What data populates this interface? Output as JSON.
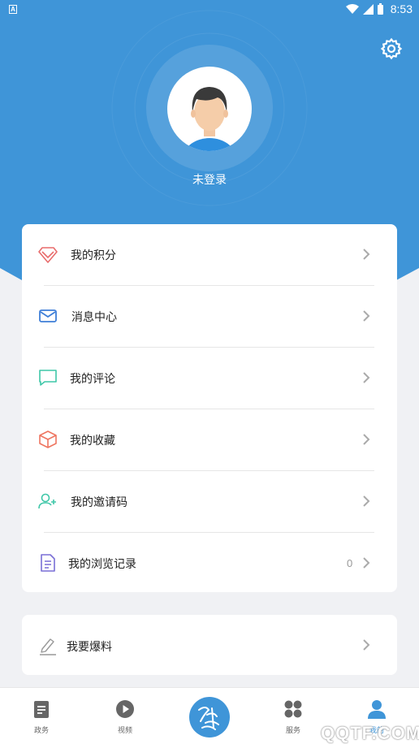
{
  "status": {
    "badge": "A",
    "time": "8:53"
  },
  "profile": {
    "status_text": "未登录"
  },
  "menu": [
    {
      "label": "我的积分"
    },
    {
      "label": "消息中心"
    },
    {
      "label": "我的评论"
    },
    {
      "label": "我的收藏"
    },
    {
      "label": "我的邀请码"
    },
    {
      "label": "我的浏览记录",
      "count": "0"
    }
  ],
  "extra": {
    "label": "我要爆料"
  },
  "tabs": [
    {
      "label": "政务"
    },
    {
      "label": "视频"
    },
    {
      "label": ""
    },
    {
      "label": "服务"
    },
    {
      "label": "我的"
    }
  ],
  "watermark": "QQTF.COM",
  "colors": {
    "primary": "#3f95d8",
    "background": "#f0f1f4"
  }
}
